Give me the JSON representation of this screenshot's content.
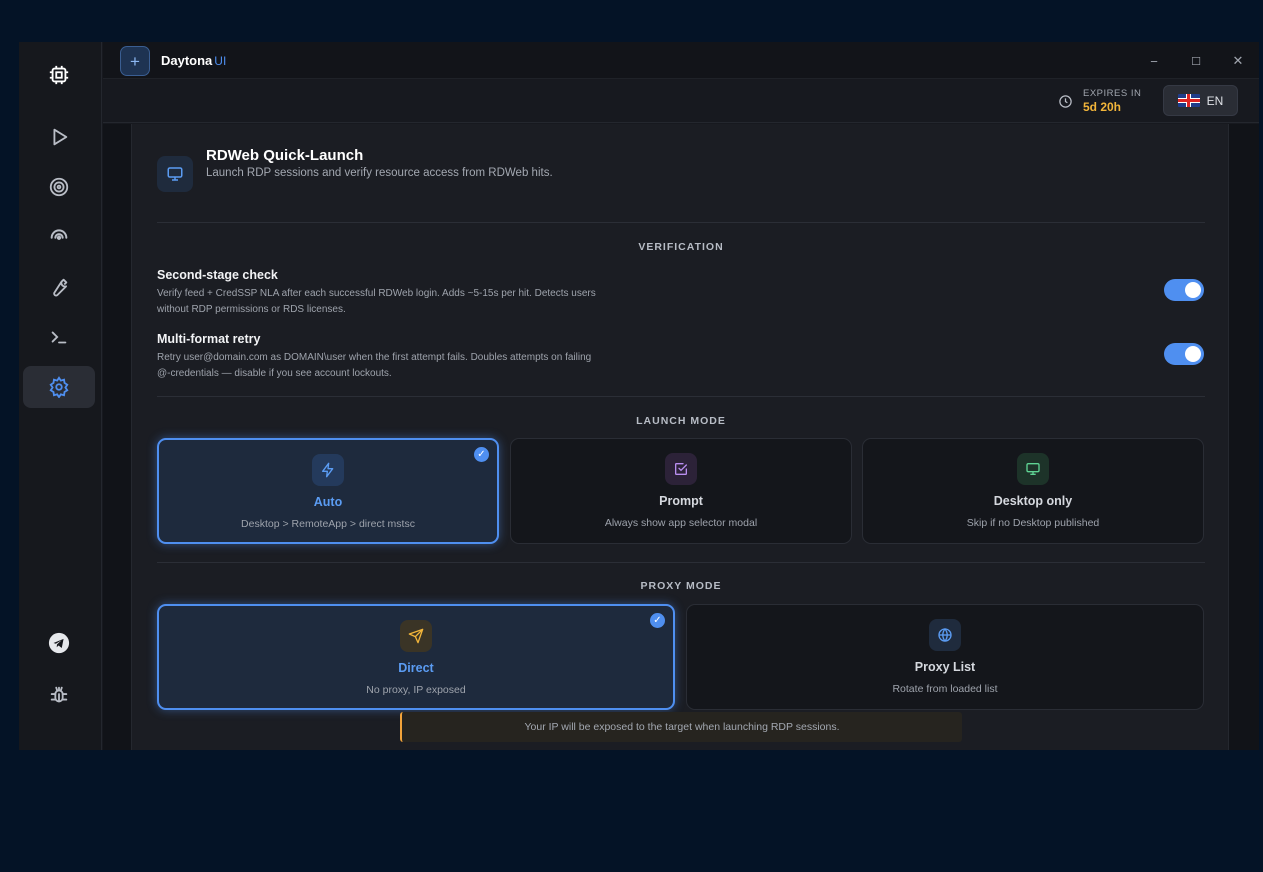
{
  "app": {
    "name": "Daytona",
    "suffix": "UI",
    "new_button": "+"
  },
  "window_controls": {
    "minimize": "−",
    "maximize": "☐",
    "close": "✕"
  },
  "sidebar": {
    "items": [
      {
        "name": "cpu-icon"
      },
      {
        "name": "play-icon"
      },
      {
        "name": "target-icon"
      },
      {
        "name": "signal-icon"
      },
      {
        "name": "wrench-icon"
      },
      {
        "name": "terminal-icon"
      },
      {
        "name": "gear-icon",
        "active": true
      },
      {
        "name": "telegram-icon"
      },
      {
        "name": "bug-icon"
      }
    ]
  },
  "topbar": {
    "expires_label": "EXPIRES IN",
    "expires_value": "5d 20h",
    "language": "EN"
  },
  "header": {
    "title": "RDWeb Quick-Launch",
    "subtitle": "Launch RDP sessions and verify resource access from RDWeb hits."
  },
  "verification": {
    "label": "VERIFICATION",
    "options": [
      {
        "title": "Second-stage check",
        "desc": "Verify feed + CredSSP NLA after each successful RDWeb login. Adds ~5-15s per hit. Detects users without RDP permissions or RDS licenses.",
        "enabled": true
      },
      {
        "title": "Multi-format retry",
        "desc": "Retry user@domain.com as DOMAIN\\user when the first attempt fails. Doubles attempts on failing @-credentials — disable if you see account lockouts.",
        "enabled": true
      }
    ]
  },
  "launch_mode": {
    "label": "LAUNCH MODE",
    "options": [
      {
        "title": "Auto",
        "sub": "Desktop > RemoteApp > direct mstsc",
        "icon": "bolt-icon",
        "selected": true
      },
      {
        "title": "Prompt",
        "sub": "Always show app selector modal",
        "icon": "checkbox-icon",
        "selected": false
      },
      {
        "title": "Desktop only",
        "sub": "Skip if no Desktop published",
        "icon": "monitor-icon",
        "selected": false
      }
    ]
  },
  "proxy_mode": {
    "label": "PROXY MODE",
    "options": [
      {
        "title": "Direct",
        "sub": "No proxy, IP exposed",
        "icon": "send-icon",
        "selected": true
      },
      {
        "title": "Proxy List",
        "sub": "Rotate from loaded list",
        "icon": "globe-icon",
        "selected": false
      }
    ],
    "warning": "Your IP will be exposed to the target when launching RDP sessions."
  },
  "colors": {
    "accent": "#4f8ff0",
    "warning": "#f2a33a",
    "expires": "#f2b53a",
    "background": "#041326"
  }
}
